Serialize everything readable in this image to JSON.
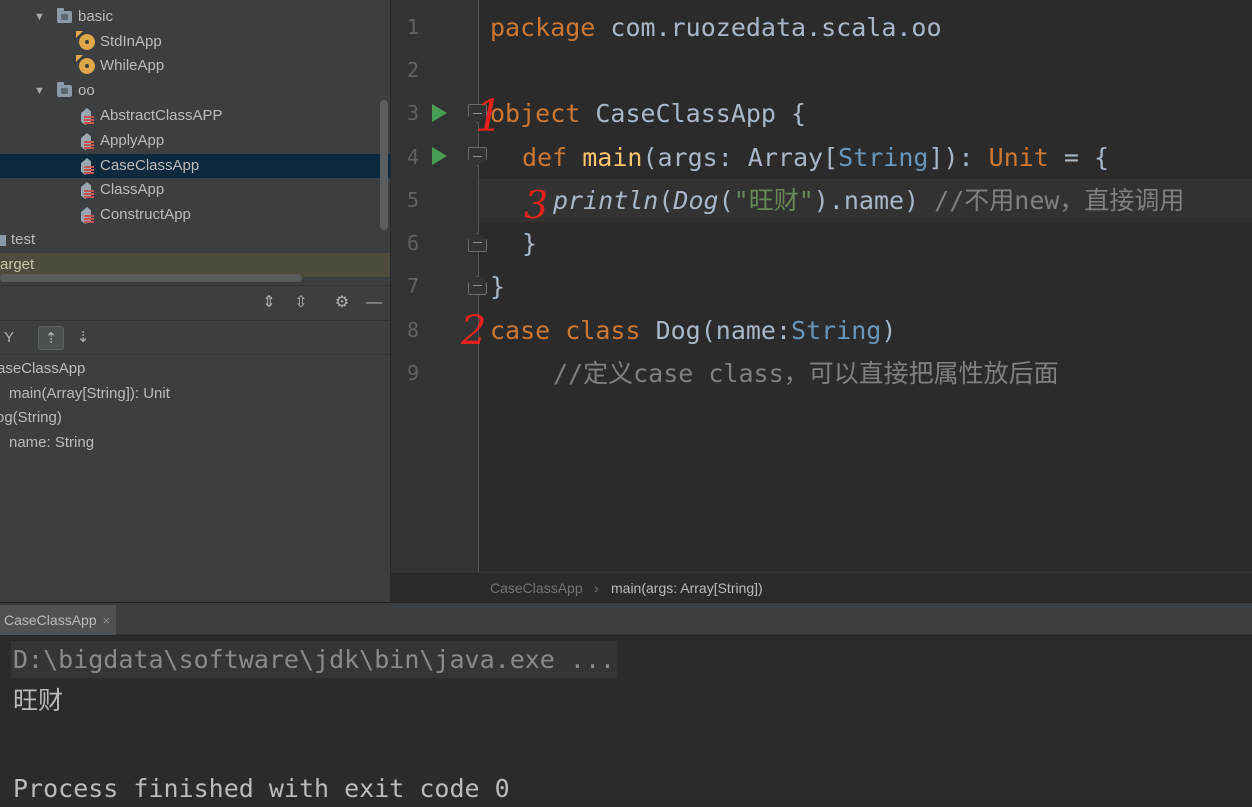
{
  "colors": {
    "keyword": "#cc7832",
    "function": "#ffc66d",
    "type": "#6897bb",
    "string": "#6a8759",
    "comment": "#808080",
    "annotation_red": "#e5231b",
    "run_green": "#499c54",
    "selection": "#0d293e"
  },
  "project_tree": {
    "items": [
      {
        "label": "basic",
        "icon": "folder-icon"
      },
      {
        "label": "StdInApp",
        "icon": "scala-object-icon"
      },
      {
        "label": "WhileApp",
        "icon": "scala-object-icon"
      },
      {
        "label": "oo",
        "icon": "folder-icon"
      },
      {
        "label": "AbstractClassAPP",
        "icon": "scala-class-icon"
      },
      {
        "label": "ApplyApp",
        "icon": "scala-class-icon"
      },
      {
        "label": "CaseClassApp",
        "icon": "scala-class-icon",
        "selected": true
      },
      {
        "label": "ClassApp",
        "icon": "scala-class-icon"
      },
      {
        "label": "ConstructApp",
        "icon": "scala-class-icon"
      },
      {
        "label": "test",
        "icon": "folder-icon"
      },
      {
        "label": "arget",
        "icon": ""
      }
    ]
  },
  "structure": {
    "items": [
      {
        "label": "aseClassApp"
      },
      {
        "label": "main(Array[String]): Unit"
      },
      {
        "label": "og(String)"
      },
      {
        "label": "name: String"
      }
    ]
  },
  "editor": {
    "line_numbers": [
      "1",
      "2",
      "3",
      "4",
      "5",
      "6",
      "7",
      "8",
      "9"
    ],
    "tokens": {
      "l1_kw": "package",
      "l1_pkg": " com.ruozedata.scala.oo",
      "l3_kw": "object",
      "l3_name": " CaseClassApp {",
      "l4_kw": "def",
      "l4_fn": "main",
      "l4_a": "(args: Array[",
      "l4_ty": "String",
      "l4_b": "]): ",
      "l4_unit": "Unit",
      "l4_c": " = {",
      "l5_println": "println",
      "l5_a": "(",
      "l5_dog": "Dog",
      "l5_b": "(",
      "l5_str": "\"旺财\"",
      "l5_c": ").name) ",
      "l5_cmt": "//不用new，直接调用",
      "l6": "}",
      "l7": "}",
      "l8_kw": "case class",
      "l8_a": " Dog(name:",
      "l8_ty": "String",
      "l8_b": ")",
      "l9_cmt": "//定义case class，可以直接把属性放后面"
    },
    "annotations": {
      "one": "1",
      "two": "2",
      "three": "3"
    }
  },
  "breadcrumb": {
    "items": [
      "CaseClassApp",
      "main(args: Array[String])"
    ],
    "separator": "›"
  },
  "run_panel": {
    "tab_label": "CaseClassApp",
    "close_glyph": "×",
    "lines": [
      "D:\\bigdata\\software\\jdk\\bin\\java.exe ...",
      "旺财",
      "",
      "Process finished with exit code 0"
    ]
  }
}
